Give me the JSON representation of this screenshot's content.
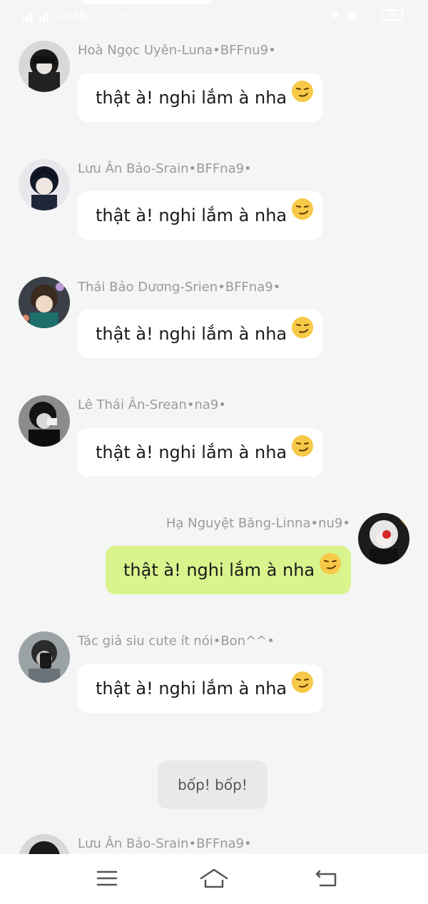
{
  "status_bar": {
    "time": "13:38",
    "left_glyphs": "ⓒ ⓕ ⓜ ···",
    "battery": "68"
  },
  "messages": [
    {
      "sender": "Hoà Ngọc Uyên-Luna•BFFnu9•",
      "text": "thật à! nghi lắm à nha",
      "emoji": "smirk-emoji",
      "side": "left"
    },
    {
      "sender": "Lưu Ân Bảo-Srain•BFFna9•",
      "text": "thật à! nghi lắm à nha",
      "emoji": "smirk-emoji",
      "side": "left"
    },
    {
      "sender": "Thái Bảo Dương-Srien•BFFna9•",
      "text": "thật à! nghi lắm à nha",
      "emoji": "smirk-emoji",
      "side": "left"
    },
    {
      "sender": "Lê Thái Ân-Srean•na9•",
      "text": "thật à! nghi lắm à nha",
      "emoji": "smirk-emoji",
      "side": "left"
    },
    {
      "sender": "Hạ Nguyệt Băng-Linna•nu9•",
      "text": "thật à! nghi lắm à nha",
      "emoji": "smirk-emoji",
      "side": "right"
    },
    {
      "sender": "Tác giả siu cute ít nói•Bon^^•",
      "text": "thật à! nghi lắm à nha",
      "emoji": "smirk-emoji",
      "side": "left"
    }
  ],
  "system_message": "bốp! bốp!",
  "last_sender": "Lưu Ân Bảo-Srain•BFFna9•",
  "colors": {
    "background": "#f5f5f5",
    "incoming_bubble": "#ffffff",
    "outgoing_bubble": "#d9f48c",
    "sender_name": "#9a9a9a"
  },
  "nav": {
    "menu_icon": "menu-icon",
    "home_icon": "home-icon",
    "back_icon": "back-icon"
  }
}
